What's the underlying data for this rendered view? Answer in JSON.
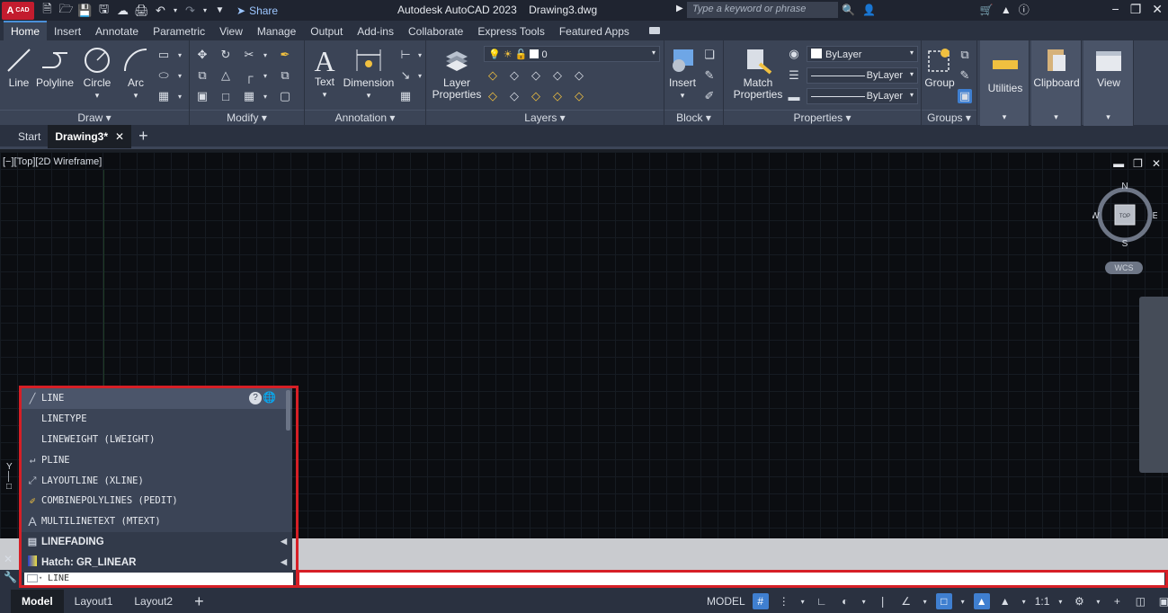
{
  "app": {
    "logo": "A",
    "logo_sub": "CAD",
    "title": "Autodesk AutoCAD 2023",
    "drawing": "Drawing3.dwg",
    "share": "Share",
    "search_placeholder": "Type a keyword or phrase"
  },
  "ribbon_tabs": [
    "Home",
    "Insert",
    "Annotate",
    "Parametric",
    "View",
    "Manage",
    "Output",
    "Add-ins",
    "Collaborate",
    "Express Tools",
    "Featured Apps"
  ],
  "draw": {
    "title": "Draw",
    "line": "Line",
    "polyline": "Polyline",
    "circle": "Circle",
    "arc": "Arc"
  },
  "modify": {
    "title": "Modify"
  },
  "annotation": {
    "title": "Annotation",
    "text": "Text",
    "dimension": "Dimension"
  },
  "layers": {
    "title": "Layers",
    "props1": "Layer",
    "props2": "Properties",
    "current": "0"
  },
  "block": {
    "title": "Block",
    "insert": "Insert"
  },
  "properties": {
    "title": "Properties",
    "match1": "Match",
    "match2": "Properties",
    "color": "ByLayer",
    "linetype": "ByLayer",
    "lineweight": "ByLayer"
  },
  "groups": {
    "title": "Groups",
    "group": "Group"
  },
  "utilities": "Utilities",
  "clipboard": "Clipboard",
  "view": "View",
  "doc_tabs": {
    "start": "Start",
    "active": "Drawing3*"
  },
  "viewport": {
    "label": "[−][Top][2D Wireframe]"
  },
  "compass": {
    "n": "N",
    "s": "S",
    "e": "E",
    "w": "W",
    "top": "TOP",
    "wcs": "WCS"
  },
  "autocomplete": [
    {
      "icon": "line",
      "label": "LINE",
      "kind": "cmd"
    },
    {
      "icon": "",
      "label": "LINETYPE",
      "kind": "cmd"
    },
    {
      "icon": "",
      "label": "LINEWEIGHT (LWEIGHT)",
      "kind": "cmd"
    },
    {
      "icon": "pline",
      "label": "PLINE",
      "kind": "cmd"
    },
    {
      "icon": "xline",
      "label": "LAYOUTLINE (XLINE)",
      "kind": "cmd"
    },
    {
      "icon": "pedit",
      "label": "COMBINEPOLYLINES (PEDIT)",
      "kind": "cmd"
    },
    {
      "icon": "mtext",
      "label": "MULTILINETEXT (MTEXT)",
      "kind": "cmd"
    },
    {
      "icon": "var",
      "label": "LINEFADING",
      "kind": "group"
    },
    {
      "icon": "hatch",
      "label": "Hatch: GR_LINEAR",
      "kind": "group"
    }
  ],
  "command": {
    "value": "LINE"
  },
  "layout_tabs": [
    "Model",
    "Layout1",
    "Layout2"
  ],
  "status": {
    "model": "MODEL",
    "scale": "1:1"
  }
}
